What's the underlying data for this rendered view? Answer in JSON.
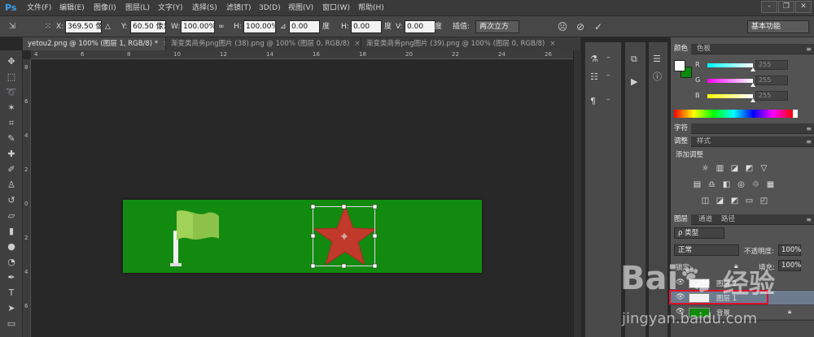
{
  "app": {
    "logo": "Ps"
  },
  "menu": [
    "文件(F)",
    "编辑(E)",
    "图像(I)",
    "图层(L)",
    "文字(Y)",
    "选择(S)",
    "滤镜(T)",
    "3D(D)",
    "视图(V)",
    "窗口(W)",
    "帮助(H)"
  ],
  "window_controls": {
    "minimize": "-",
    "restore": "❐",
    "close": "✕"
  },
  "options": {
    "x_label": "X:",
    "x_value": "369.50 像素",
    "y_label": "Y:",
    "y_value": "60.50 像素",
    "w_label": "W:",
    "w_value": "100.00%",
    "h_label": "H:",
    "h_value": "100.00%",
    "angle_value": "0.00",
    "angle_unit": "度",
    "hskew_label": "H:",
    "hskew_value": "0.00",
    "hskew_unit": "度",
    "vskew_label": "V:",
    "vskew_value": "0.00",
    "vskew_unit": "度",
    "interp_label": "插值:",
    "interp_value": "两次立方",
    "workspace": "基本功能"
  },
  "tabs": [
    {
      "label": "yetou2.png @ 100% (图层 1, RGB/8) *",
      "active": true
    },
    {
      "label": "渐变类商务png图片 (38).png @ 100% (图层 0, RGB/8)",
      "active": false
    },
    {
      "label": "渐变类商务png图片 (39).png @ 100% (图层 0, RGB/8)",
      "active": false
    }
  ],
  "ruler_top_ticks": [
    "4",
    "6",
    "8",
    "10",
    "12",
    "14",
    "16",
    "18",
    "20",
    "22",
    "24",
    "26"
  ],
  "ruler_left_ticks": [
    "8",
    "6",
    "4",
    "2",
    "0",
    "2",
    "4",
    "6"
  ],
  "panels": {
    "color": {
      "tabs": [
        "颜色",
        "色板"
      ],
      "r_label": "R",
      "r_value": "255",
      "g_label": "G",
      "g_value": "255",
      "b_label": "B",
      "b_value": "255",
      "fg_color": "#ffffff",
      "bg_color": "#0b8a0b"
    },
    "character": {
      "tab": "字符"
    },
    "adjustments": {
      "tabs": [
        "调整",
        "样式"
      ],
      "heading": "添加调整"
    },
    "layers": {
      "tabs": [
        "图层",
        "通道",
        "路径"
      ],
      "filter_kind": "ρ 类型",
      "blend_mode": "正常",
      "opacity_label": "不透明度:",
      "opacity_value": "100%",
      "lock_label": "锁定:",
      "fill_label": "填充:",
      "fill_value": "100%",
      "rows": [
        {
          "name": "图层 2",
          "selected": false
        },
        {
          "name": "图层 1",
          "selected": true
        },
        {
          "name": "背景",
          "selected": false
        }
      ]
    }
  },
  "watermark": {
    "brand": "Bai",
    "brand2": "经验",
    "url": "jingyan.baidu.com"
  },
  "colors": {
    "document_bg": "#128a0f",
    "star": "#c0392b",
    "flag": "#8bc34a"
  }
}
